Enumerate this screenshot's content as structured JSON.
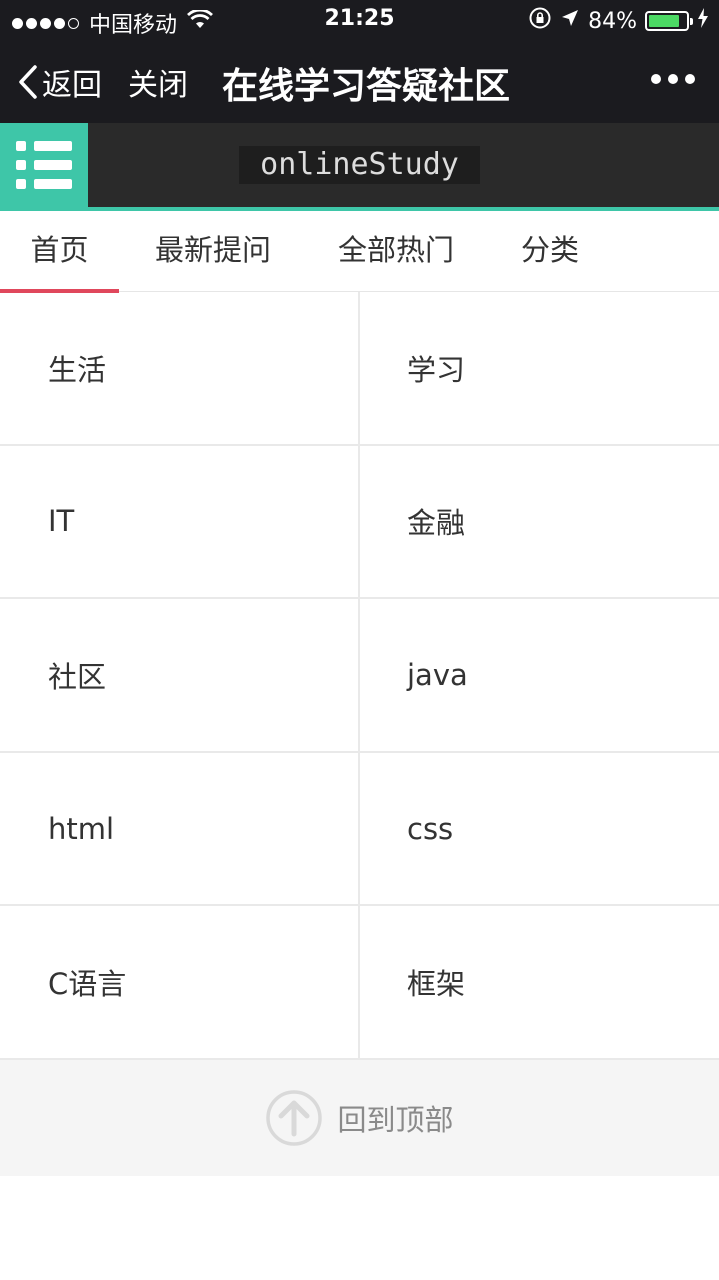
{
  "status_bar": {
    "carrier": "中国移动",
    "time": "21:25",
    "battery_percent": "84%",
    "battery_level": 0.84,
    "icons": [
      "signal-dots-icon",
      "wifi-icon",
      "rotation-lock-icon",
      "location-arrow-icon",
      "battery-icon",
      "charging-bolt-icon"
    ]
  },
  "nav": {
    "back_label": "返回",
    "close_label": "关闭",
    "title": "在线学习答疑社区"
  },
  "app_header": {
    "logo_text": "onlineStudy",
    "accent_color": "#3ec6a8"
  },
  "tabs": [
    {
      "label": "首页",
      "active": true
    },
    {
      "label": "最新提问",
      "active": false
    },
    {
      "label": "全部热门",
      "active": false
    },
    {
      "label": "分类",
      "active": false
    }
  ],
  "active_tab_color": "#e0475c",
  "categories": [
    {
      "label": "生活"
    },
    {
      "label": "学习"
    },
    {
      "label": "IT"
    },
    {
      "label": "金融"
    },
    {
      "label": "社区"
    },
    {
      "label": "java"
    },
    {
      "label": "html"
    },
    {
      "label": "css"
    },
    {
      "label": "C语言"
    },
    {
      "label": "框架"
    }
  ],
  "back_to_top": {
    "label": "回到顶部",
    "icon": "arrow-up-circle-icon"
  }
}
